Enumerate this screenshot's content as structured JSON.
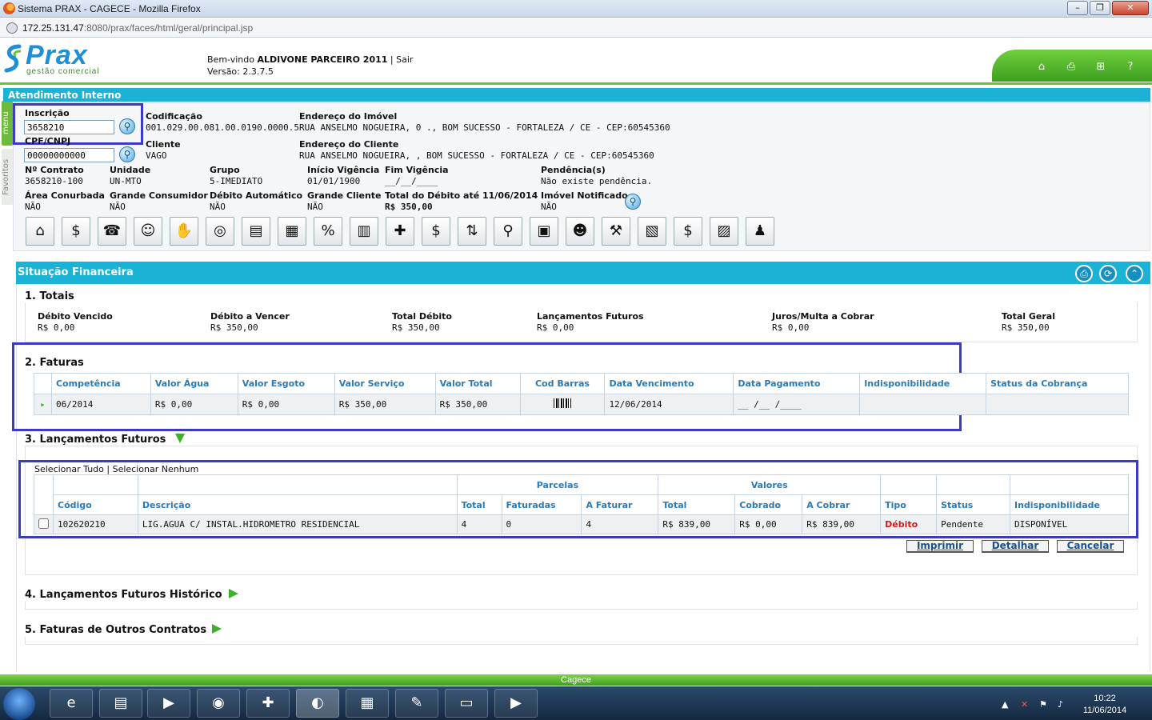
{
  "window": {
    "title": "Sistema PRAX - CAGECE - Mozilla Firefox"
  },
  "url": {
    "host": "172.25.131.47",
    "path": ":8080/prax/faces/html/geral/principal.jsp"
  },
  "header": {
    "logo": "Prax",
    "logo_sub": "gestão comercial",
    "welcome_prefix": "Bem-vindo",
    "user": "ALDIVONE PARCEIRO 2011",
    "separator": "|",
    "logout": "Sair",
    "version_label": "Versão: 2.3.7.5",
    "icons": [
      "home-icon",
      "print-icon",
      "sitemap-icon",
      "help-icon"
    ],
    "help_glyph": "?"
  },
  "left_tabs": {
    "menu": "menu",
    "favoritos": "Favoritos"
  },
  "atendimento": {
    "title": "Atendimento Interno",
    "inscricao_label": "Inscrição",
    "inscricao_value": "3658210",
    "cpf_label": "CPF/CNPJ",
    "cpf_value": "00000000000",
    "codificacao_label": "Codificação",
    "codificacao_value": "001.029.00.081.00.0190.0000.5",
    "endereco_imovel_label": "Endereço do Imóvel",
    "endereco_imovel_value": "RUA ANSELMO NOGUEIRA, 0 ., BOM SUCESSO - FORTALEZA / CE - CEP:60545360",
    "cliente_label": "Cliente",
    "cliente_value": "VAGO",
    "endereco_cliente_label": "Endereço do Cliente",
    "endereco_cliente_value": "RUA ANSELMO NOGUEIRA, , BOM SUCESSO - FORTALEZA / CE - CEP:60545360",
    "contrato_label": "Nº Contrato",
    "contrato_value": "3658210-100",
    "unidade_label": "Unidade",
    "unidade_value": "UN-MTO",
    "grupo_label": "Grupo",
    "grupo_value": "5-IMEDIATO",
    "inicio_label": "Início Vigência",
    "inicio_value": "01/01/1900",
    "fim_label": "Fim Vigência",
    "fim_value": "__/__/____",
    "pendencia_label": "Pendência(s)",
    "pendencia_value": "Não existe pendência.",
    "area_label": "Área Conurbada",
    "area_value": "NÃO",
    "grande_consumidor_label": "Grande Consumidor",
    "grande_consumidor_value": "NÃO",
    "debito_auto_label": "Débito Automático",
    "debito_auto_value": "NÃO",
    "grande_cliente_label": "Grande Cliente",
    "grande_cliente_value": "NÃO",
    "total_debito_label": "Total do Débito até 11/06/2014",
    "total_debito_value": "R$  350,00",
    "imovel_notificado_label": "Imóvel Notificado",
    "imovel_notificado_value": "NÃO"
  },
  "toolbar_icons": [
    "house-icon",
    "dollar-icon",
    "phone-icon",
    "smiley-icon",
    "handshake-icon",
    "coins-icon",
    "money-icon",
    "cash-register-icon",
    "percent-icon",
    "spreadsheet-icon",
    "coins-add-icon",
    "house-dollar-icon",
    "transfer-arrows-icon",
    "search-document-icon",
    "bank-icon",
    "people-icon",
    "hammer-icon",
    "calculator-money-icon",
    "dollar-badge-icon",
    "chart-money-icon",
    "person-dollar-icon"
  ],
  "toolbar_glyphs": [
    "⌂",
    "$",
    "☎",
    "☺",
    "✋",
    "◎",
    "▤",
    "▦",
    "%",
    "▥",
    "✚",
    "$",
    "⇅",
    "⚲",
    "▣",
    "☻",
    "⚒",
    "▧",
    "$",
    "▨",
    "♟"
  ],
  "situacao": {
    "title": "Situação Financeira",
    "icons": [
      "print-icon",
      "refresh-icon",
      "collapse-up-icon"
    ],
    "totais_title": "1. Totais",
    "totais": [
      {
        "label": "Débito Vencido",
        "value": "R$ 0,00"
      },
      {
        "label": "Débito a Vencer",
        "value": "R$ 350,00"
      },
      {
        "label": "Total Débito",
        "value": "R$ 350,00"
      },
      {
        "label": "Lançamentos Futuros",
        "value": "R$ 0,00"
      },
      {
        "label": "Juros/Multa a Cobrar",
        "value": "R$ 0,00"
      },
      {
        "label": "Total Geral",
        "value": "R$ 350,00"
      }
    ],
    "faturas_title": "2. Faturas",
    "faturas_headers": [
      "Competência",
      "Valor Água",
      "Valor Esgoto",
      "Valor Serviço",
      "Valor Total",
      "Cod Barras",
      "Data Vencimento",
      "Data Pagamento",
      "Indisponibilidade",
      "Status da Cobrança"
    ],
    "faturas_rows": [
      [
        "06/2014",
        "R$ 0,00",
        "R$ 0,00",
        "R$ 350,00",
        "R$ 350,00",
        "",
        "12/06/2014",
        "__ /__ /____",
        "",
        ""
      ]
    ],
    "lanc_title": "3. Lançamentos Futuros",
    "select_all": "Selecionar Tudo",
    "select_sep": "|",
    "select_none": "Selecionar Nenhum",
    "lanc_group_parcelas": "Parcelas",
    "lanc_group_valores": "Valores",
    "lanc_headers": [
      "Código",
      "Descrição",
      "Total",
      "Faturadas",
      "A Faturar",
      "Total",
      "Cobrado",
      "A Cobrar",
      "Tipo",
      "Status",
      "Indisponibilidade"
    ],
    "lanc_rows": [
      [
        "102620210",
        "LIG.AGUA C/ INSTAL.HIDROMETRO RESIDENCIAL",
        "4",
        "0",
        "4",
        "R$ 839,00",
        "R$ 0,00",
        "R$ 839,00",
        "Débito",
        "Pendente",
        "DISPONÍVEL"
      ]
    ],
    "tipo_color": "#d21d1d",
    "btn_imprimir": "Imprimir",
    "btn_detalhar": "Detalhar",
    "btn_cancelar": "Cancelar",
    "hist_title": "4. Lançamentos Futuros Histórico",
    "outros_title": "5. Faturas de Outros Contratos"
  },
  "footer": {
    "brand": "Cagece"
  },
  "taskbar": {
    "apps": [
      "ie-icon",
      "explorer-icon",
      "media-player-icon",
      "chrome-icon",
      "aplicativo-icon",
      "firefox-icon",
      "documents-icon",
      "paint-icon",
      "notepad-icon",
      "media-center-icon"
    ],
    "glyphs": [
      "e",
      "▤",
      "▶",
      "◉",
      "✚",
      "◐",
      "▦",
      "✎",
      "▭",
      "▶"
    ],
    "time": "10:22",
    "date": "11/06/2014"
  },
  "colors": {
    "accent": "#1ab3d6",
    "brand_green": "#4caf2a",
    "highlight": "#3b3bbf",
    "link_blue": "#2a7ab8"
  }
}
